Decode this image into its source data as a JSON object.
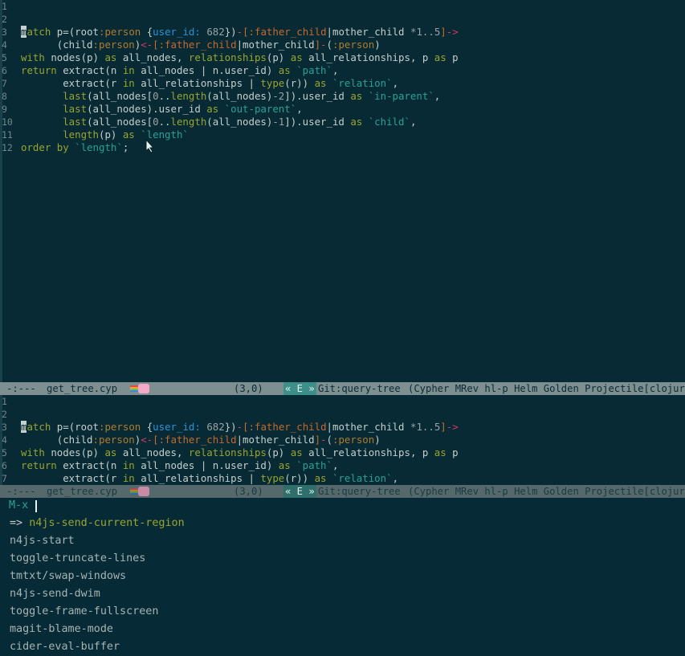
{
  "editor_top": {
    "lines": [
      {
        "n": "1",
        "segs": []
      },
      {
        "n": "2",
        "segs": []
      },
      {
        "n": "3",
        "segs": [
          [
            "cursor-char",
            "m"
          ],
          [
            "kw",
            "atch "
          ],
          [
            "fn",
            "p=("
          ],
          [
            "fn",
            "root"
          ],
          [
            "lbl",
            ":person "
          ],
          [
            "fn",
            "{"
          ],
          [
            "prop",
            "user_id:"
          ],
          [
            "num",
            " 682"
          ],
          [
            "fn",
            "})"
          ],
          [
            "relbr",
            "-"
          ],
          [
            "rel",
            "[:father_child"
          ],
          [
            "fn",
            "|"
          ],
          [
            "fn",
            "mother_child "
          ],
          [
            "num",
            "*1..5"
          ],
          [
            "rel",
            "]"
          ],
          [
            "relbr",
            "->"
          ]
        ]
      },
      {
        "n": "4",
        "segs": [
          [
            "fn",
            "      (child"
          ],
          [
            "lbl",
            ":person"
          ],
          [
            "fn",
            ")"
          ],
          [
            "relbr",
            "<-"
          ],
          [
            "rel",
            "[:father_child"
          ],
          [
            "fn",
            "|"
          ],
          [
            "fn",
            "mother_child"
          ],
          [
            "rel",
            "]"
          ],
          [
            "relbr",
            "-"
          ],
          [
            "fn",
            "("
          ],
          [
            "lbl",
            ":person"
          ],
          [
            "fn",
            ")"
          ]
        ]
      },
      {
        "n": "5",
        "segs": [
          [
            "kw",
            "with "
          ],
          [
            "fn",
            "nodes(p) "
          ],
          [
            "kw",
            "as "
          ],
          [
            "fn",
            "all_nodes, "
          ],
          [
            "kw",
            "relationships"
          ],
          [
            "fn",
            "(p) "
          ],
          [
            "kw",
            "as "
          ],
          [
            "fn",
            "all_relationships, p "
          ],
          [
            "kw",
            "as "
          ],
          [
            "fn",
            "p"
          ]
        ]
      },
      {
        "n": "6",
        "segs": [
          [
            "kw",
            "return "
          ],
          [
            "fn",
            "extract(n "
          ],
          [
            "kw",
            "in "
          ],
          [
            "fn",
            "all_nodes | n.user_id) "
          ],
          [
            "kw",
            "as "
          ],
          [
            "strq",
            "`path`"
          ],
          [
            "fn",
            ","
          ]
        ]
      },
      {
        "n": "7",
        "segs": [
          [
            "fn",
            "       extract(r "
          ],
          [
            "kw",
            "in "
          ],
          [
            "fn",
            "all_relationships | "
          ],
          [
            "kw",
            "type"
          ],
          [
            "fn",
            "(r)) "
          ],
          [
            "kw",
            "as "
          ],
          [
            "strq",
            "`relation`"
          ],
          [
            "fn",
            ","
          ]
        ]
      },
      {
        "n": "8",
        "segs": [
          [
            "kw",
            "       last"
          ],
          [
            "fn",
            "(all_nodes["
          ],
          [
            "num",
            "0"
          ],
          [
            "fn",
            ".."
          ],
          [
            "kw",
            "length"
          ],
          [
            "fn",
            "(all_nodes)"
          ],
          [
            "num",
            "-2"
          ],
          [
            "fn",
            "]).user_id "
          ],
          [
            "kw",
            "as "
          ],
          [
            "strq",
            "`in-parent`"
          ],
          [
            "fn",
            ","
          ]
        ]
      },
      {
        "n": "9",
        "segs": [
          [
            "kw",
            "       last"
          ],
          [
            "fn",
            "(all_nodes).user_id "
          ],
          [
            "kw",
            "as "
          ],
          [
            "strq",
            "`out-parent`"
          ],
          [
            "fn",
            ","
          ]
        ]
      },
      {
        "n": "10",
        "segs": [
          [
            "kw",
            "       last"
          ],
          [
            "fn",
            "(all_nodes["
          ],
          [
            "num",
            "0"
          ],
          [
            "fn",
            ".."
          ],
          [
            "kw",
            "length"
          ],
          [
            "fn",
            "(all_nodes)"
          ],
          [
            "num",
            "-1"
          ],
          [
            "fn",
            "]).user_id "
          ],
          [
            "kw",
            "as "
          ],
          [
            "strq",
            "`child`"
          ],
          [
            "fn",
            ","
          ]
        ]
      },
      {
        "n": "11",
        "segs": [
          [
            "kw",
            "       length"
          ],
          [
            "fn",
            "(p) "
          ],
          [
            "kw",
            "as "
          ],
          [
            "strq",
            "`length`"
          ]
        ]
      },
      {
        "n": "12",
        "segs": [
          [
            "kw",
            "order by "
          ],
          [
            "strq",
            "`length`"
          ],
          [
            "fn",
            ";"
          ]
        ]
      }
    ]
  },
  "editor_bottom": {
    "lines": [
      {
        "n": "1",
        "segs": []
      },
      {
        "n": "2",
        "segs": []
      },
      {
        "n": "3",
        "segs": [
          [
            "cursor-char",
            "m"
          ],
          [
            "kw",
            "atch "
          ],
          [
            "fn",
            "p=("
          ],
          [
            "fn",
            "root"
          ],
          [
            "lbl",
            ":person "
          ],
          [
            "fn",
            "{"
          ],
          [
            "prop",
            "user_id:"
          ],
          [
            "num",
            " 682"
          ],
          [
            "fn",
            "})"
          ],
          [
            "relbr",
            "-"
          ],
          [
            "rel",
            "[:father_child"
          ],
          [
            "fn",
            "|"
          ],
          [
            "fn",
            "mother_child "
          ],
          [
            "num",
            "*1..5"
          ],
          [
            "rel",
            "]"
          ],
          [
            "relbr",
            "->"
          ]
        ]
      },
      {
        "n": "4",
        "segs": [
          [
            "fn",
            "      (child"
          ],
          [
            "lbl",
            ":person"
          ],
          [
            "fn",
            ")"
          ],
          [
            "relbr",
            "<-"
          ],
          [
            "rel",
            "[:father_child"
          ],
          [
            "fn",
            "|"
          ],
          [
            "fn",
            "mother_child"
          ],
          [
            "rel",
            "]"
          ],
          [
            "relbr",
            "-"
          ],
          [
            "fn",
            "("
          ],
          [
            "lbl",
            ":person"
          ],
          [
            "fn",
            ")"
          ]
        ]
      },
      {
        "n": "5",
        "segs": [
          [
            "kw",
            "with "
          ],
          [
            "fn",
            "nodes(p) "
          ],
          [
            "kw",
            "as "
          ],
          [
            "fn",
            "all_nodes, "
          ],
          [
            "kw",
            "relationships"
          ],
          [
            "fn",
            "(p) "
          ],
          [
            "kw",
            "as "
          ],
          [
            "fn",
            "all_relationships, p "
          ],
          [
            "kw",
            "as "
          ],
          [
            "fn",
            "p"
          ]
        ]
      },
      {
        "n": "6",
        "segs": [
          [
            "kw",
            "return "
          ],
          [
            "fn",
            "extract(n "
          ],
          [
            "kw",
            "in "
          ],
          [
            "fn",
            "all_nodes | n.user_id) "
          ],
          [
            "kw",
            "as "
          ],
          [
            "strq",
            "`path`"
          ],
          [
            "fn",
            ","
          ]
        ]
      },
      {
        "n": "7",
        "segs": [
          [
            "fn",
            "       extract(r "
          ],
          [
            "kw",
            "in "
          ],
          [
            "fn",
            "all_relationships | "
          ],
          [
            "kw",
            "type"
          ],
          [
            "fn",
            "(r)) "
          ],
          [
            "kw",
            "as "
          ],
          [
            "strq",
            "`relation`"
          ],
          [
            "fn",
            ","
          ]
        ]
      }
    ]
  },
  "modeline": {
    "state": "-:---",
    "filename": "get_tree.cyp",
    "position": "(3,0)",
    "e_badge": "« E »",
    "vc": "Git:query-tree",
    "modes": "(Cypher MRev hl-p Helm Golden Projectile[clojure-p"
  },
  "minibuffer": {
    "prompt": "M-x",
    "selected_arrow": "=>",
    "candidates": [
      "n4js-send-current-region",
      "n4js-start",
      "toggle-truncate-lines",
      "tmtxt/swap-windows",
      "n4js-send-dwim",
      "toggle-frame-fullscreen",
      "magit-blame-mode",
      "cider-eval-buffer"
    ]
  },
  "colors": {
    "background": "#072a34",
    "modeline": "#7d8f91",
    "keyword": "#9aa52f",
    "label": "#b07c2f",
    "property": "#2a93d6",
    "relationship": "#c66a2c",
    "arrow": "#d23a68",
    "string": "#2aa198"
  }
}
